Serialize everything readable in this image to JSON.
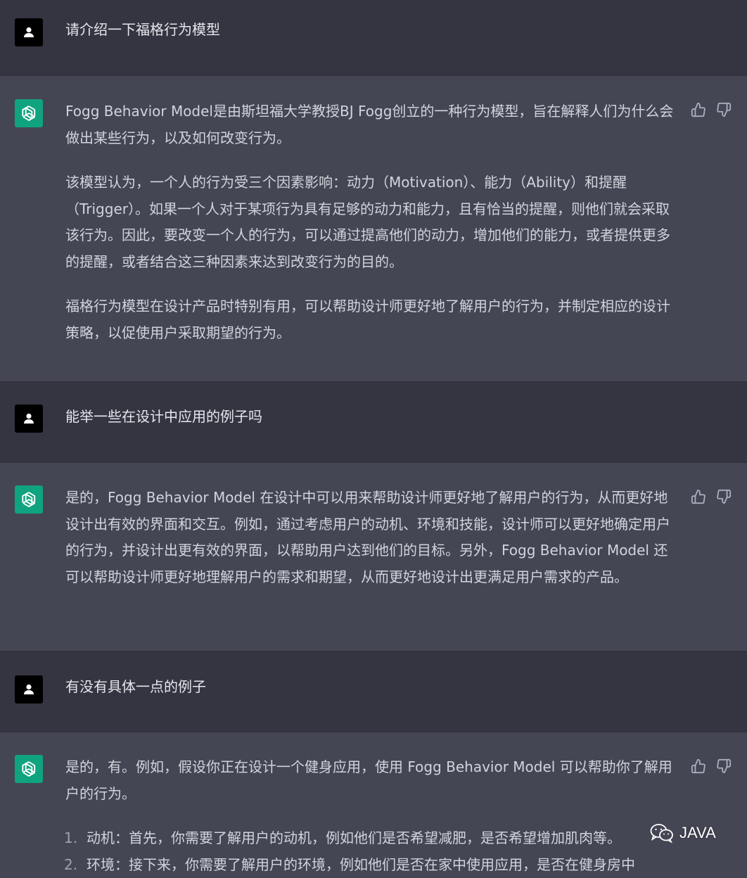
{
  "conversation": [
    {
      "role": "user",
      "text": "请介绍一下福格行为模型"
    },
    {
      "role": "assistant",
      "paragraphs": [
        "Fogg Behavior Model是由斯坦福大学教授BJ Fogg创立的一种行为模型，旨在解释人们为什么会做出某些行为，以及如何改变行为。",
        "该模型认为，一个人的行为受三个因素影响：动力（Motivation）、能力（Ability）和提醒（Trigger）。如果一个人对于某项行为具有足够的动力和能力，且有恰当的提醒，则他们就会采取该行为。因此，要改变一个人的行为，可以通过提高他们的动力，增加他们的能力，或者提供更多的提醒，或者结合这三种因素来达到改变行为的目的。",
        "福格行为模型在设计产品时特别有用，可以帮助设计师更好地了解用户的行为，并制定相应的设计策略，以促使用户采取期望的行为。"
      ]
    },
    {
      "role": "user",
      "text": "能举一些在设计中应用的例子吗"
    },
    {
      "role": "assistant",
      "paragraphs": [
        "是的，Fogg Behavior Model 在设计中可以用来帮助设计师更好地了解用户的行为，从而更好地设计出有效的界面和交互。例如，通过考虑用户的动机、环境和技能，设计师可以更好地确定用户的行为，并设计出更有效的界面，以帮助用户达到他们的目标。另外，Fogg Behavior Model 还可以帮助设计师更好地理解用户的需求和期望，从而更好地设计出更满足用户需求的产品。"
      ]
    },
    {
      "role": "user",
      "text": "有没有具体一点的例子"
    },
    {
      "role": "assistant",
      "paragraphs": [
        "是的，有。例如，假设你正在设计一个健身应用，使用 Fogg Behavior Model 可以帮助你了解用户的行为。"
      ],
      "list": [
        {
          "num": "1.",
          "text": "动机：首先，你需要了解用户的动机，例如他们是否希望减肥，是否希望增加肌肉等。"
        },
        {
          "num": "2.",
          "text": "环境：接下来，你需要了解用户的环境，例如他们是否在家中使用应用，是否在健身房中"
        }
      ]
    }
  ],
  "watermark": {
    "label": "JAVA",
    "icon": "wechat-icon"
  },
  "colors": {
    "user_bg": "#343541",
    "assistant_bg": "#444654",
    "assistant_avatar": "#10a37f",
    "text": "#d1d5db"
  }
}
